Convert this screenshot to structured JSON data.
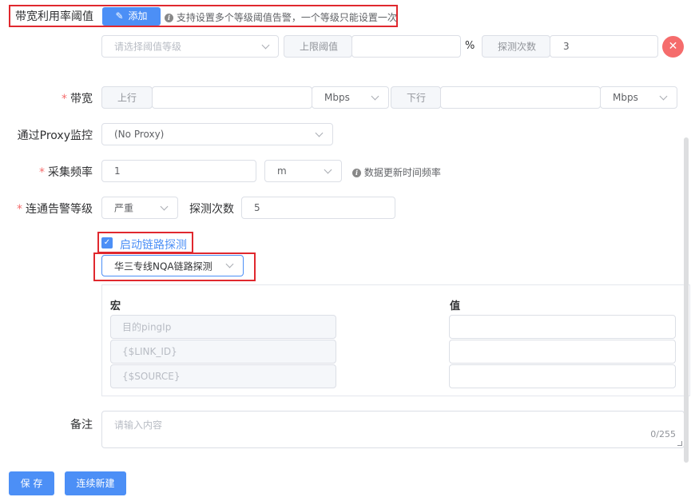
{
  "threshold": {
    "label": "带宽利用率阈值",
    "add_button": "添加",
    "hint": "支持设置多个等级阈值告警，一个等级只能设置一次",
    "level_placeholder": "请选择阈值等级",
    "upper_limit_label": "上限阈值",
    "upper_limit_value": "",
    "unit": "%",
    "probe_count_label": "探测次数",
    "probe_count_value": "3"
  },
  "bandwidth": {
    "label": "带宽",
    "up_label": "上行",
    "up_unit": "Mbps",
    "down_label": "下行",
    "down_unit": "Mbps"
  },
  "proxy": {
    "label": "通过Proxy监控",
    "value": "(No Proxy)"
  },
  "frequency": {
    "label": "采集频率",
    "value": "1",
    "unit": "m",
    "hint": "数据更新时间频率"
  },
  "connectivity": {
    "label": "连通告警等级",
    "level": "严重",
    "probe_label": "探测次数",
    "probe_value": "5"
  },
  "link_probe": {
    "checkbox_label": "启动链路探测",
    "checked": true,
    "template": "华三专线NQA链路探测"
  },
  "macro_table": {
    "macro_header": "宏",
    "value_header": "值",
    "rows": [
      {
        "macro": "目的pingIp",
        "value": ""
      },
      {
        "macro": "{$LINK_ID}",
        "value": ""
      },
      {
        "macro": "{$SOURCE}",
        "value": ""
      }
    ]
  },
  "remark": {
    "label": "备注",
    "placeholder": "请输入内容",
    "counter": "0/255"
  },
  "footer": {
    "save": "保 存",
    "continue": "连续新建"
  },
  "colors": {
    "primary": "#4c8ff6",
    "danger": "#f56c6c",
    "highlight": "#e0282e"
  }
}
